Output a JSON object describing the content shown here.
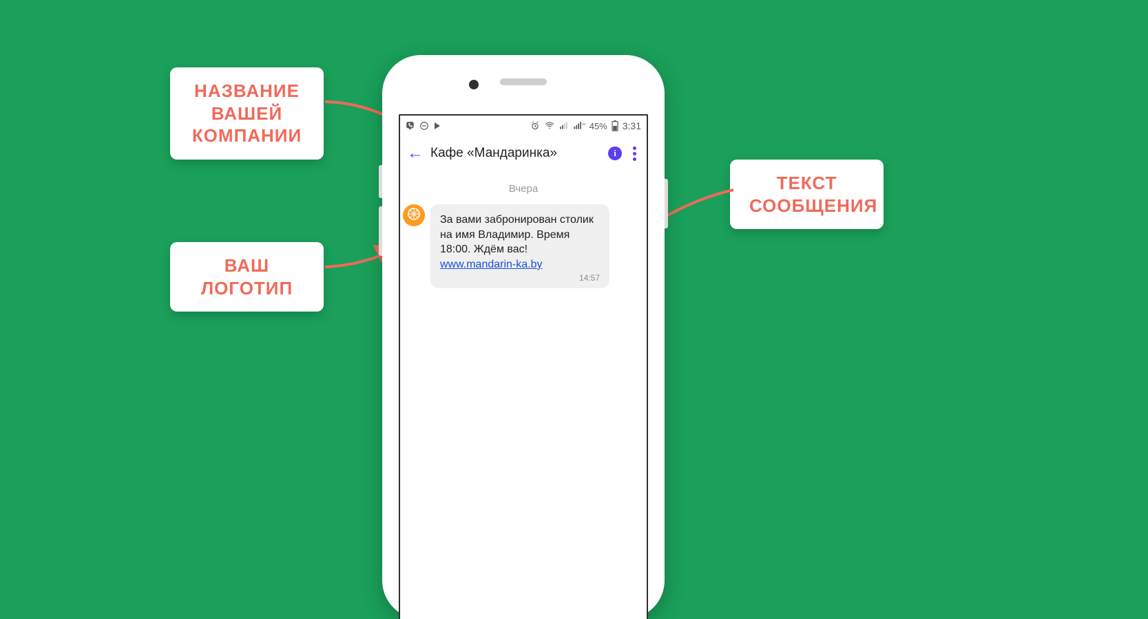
{
  "callouts": {
    "company_name": "НАЗВАНИЕ\nВАШЕЙ\nКОМПАНИИ",
    "your_logo": "ВАШ\nЛОГОТИП",
    "message_text": "ТЕКСТ\nСООБЩЕНИЯ"
  },
  "statusbar": {
    "battery_text": "45%",
    "time": "3:31"
  },
  "header": {
    "title": "Кафе «Мандаринка»"
  },
  "chat": {
    "day_label": "Вчера",
    "message_text": "За вами забронирован столик на имя Владимир. Время 18:00. Ждём вас!",
    "message_link": "www.mandarin-ka.by",
    "message_time": "14:57"
  },
  "colors": {
    "accent_red": "#f06a5a",
    "bg_green": "#1aa05a",
    "viber_purple": "#5b3ef0",
    "mandarin": "#ff9a1f"
  }
}
